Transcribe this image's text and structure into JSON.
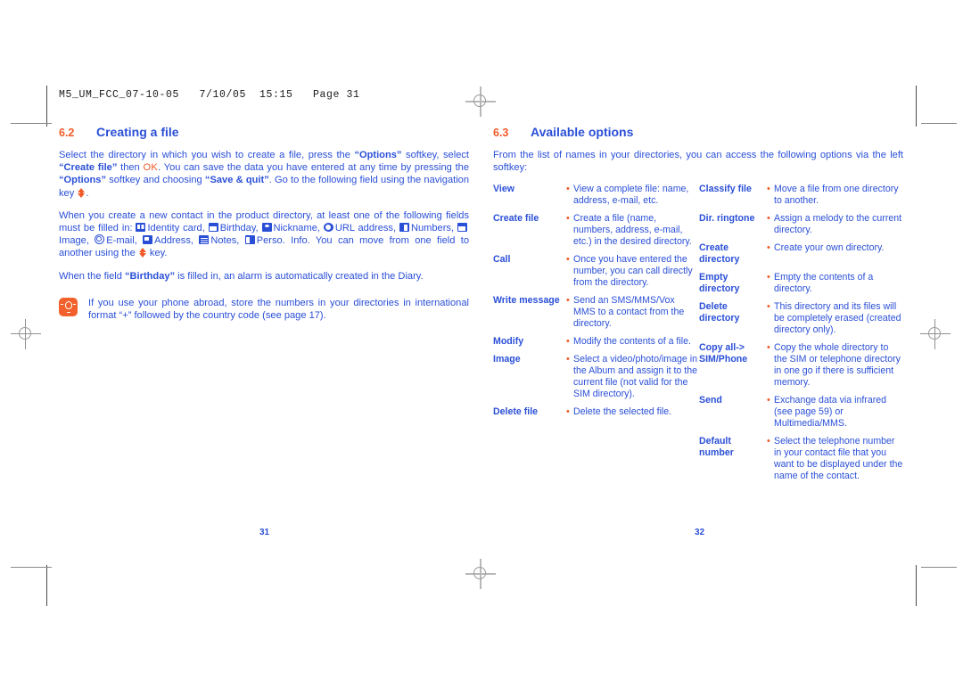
{
  "prepress": {
    "slug": "M5_UM_FCC_07-10-05   7/10/05  15:15   Page 31"
  },
  "colors": {
    "accent_orange": "#F05A28",
    "text_blue": "#2A4FD7",
    "tip_icon_bg": "#F2612C",
    "crop_mark": "#8a8a8a"
  },
  "left_page": {
    "section": {
      "number": "6.2",
      "title": "Creating a file"
    },
    "para1": {
      "t1": "Select the directory in which you wish to create a file, press the ",
      "b1": "“Options”",
      "t2": " softkey, select ",
      "b2": "“Create file”",
      "t3": " then ",
      "ok": "OK",
      "t4": ". You can save the data you have entered at any time by pressing the ",
      "b3": "“Options”",
      "t5": " softkey and choosing ",
      "b4": "“Save & quit”",
      "t6": ". Go to the following field using the navigation key ",
      "t7": "."
    },
    "para2": {
      "t1": "When you create a new contact in the product directory, at least one of the following fields must be filled in: ",
      "items": [
        {
          "icon": "idcard-icon",
          "label": "Identity card,"
        },
        {
          "icon": "cake-icon",
          "label": "Birthday,"
        },
        {
          "icon": "nickname-icon",
          "label": "Nickname,"
        },
        {
          "icon": "url-icon",
          "label": "URL address,"
        },
        {
          "icon": "numbers-icon",
          "label": "Numbers,"
        },
        {
          "icon": "image-icon",
          "label": "Image,"
        },
        {
          "icon": "email-icon",
          "label": "E-mail,"
        },
        {
          "icon": "address-icon",
          "label": "Address,"
        },
        {
          "icon": "notes-icon",
          "label": "Notes,"
        },
        {
          "icon": "perso-info-icon",
          "label": "Perso. Info."
        }
      ],
      "t2": " You can move from one field to another using the ",
      "t3": " key."
    },
    "para3": {
      "t1": "When the field ",
      "b1": "“Birthday”",
      "t2": " is filled in, an alarm is automatically created in the Diary."
    },
    "tip": {
      "icon": "tip-bulb-icon",
      "text": "If you use your phone abroad, store the numbers in your directories in international format “+” followed by the country code (see page 17)."
    },
    "page_number": "31"
  },
  "right_page": {
    "section": {
      "number": "6.3",
      "title": "Available options"
    },
    "intro": "From the list of names in your directories, you can access the following options via the left softkey:",
    "bullet": "•",
    "options_left": [
      {
        "term": "View",
        "definition": "View a complete file: name, address, e-mail, etc."
      },
      {
        "term": "Create file",
        "definition": "Create a file (name, numbers, address, e-mail, etc.) in the desired directory."
      },
      {
        "term": "Call",
        "definition": "Once you have entered the number, you can call directly from the directory."
      },
      {
        "term": "Write message",
        "definition": "Send an SMS/MMS/Vox MMS to a contact from the directory."
      },
      {
        "term": "Modify",
        "definition": "Modify the contents of a file."
      },
      {
        "term": "Image",
        "definition": "Select a video/photo/image in the Album and assign it to the current file (not valid for the SIM directory)."
      },
      {
        "term": "Delete file",
        "definition": "Delete the selected file."
      }
    ],
    "options_right": [
      {
        "term": "Classify file",
        "definition": "Move a file from one directory to another."
      },
      {
        "term": "Dir. ringtone",
        "definition": "Assign a melody to the current directory."
      },
      {
        "term": "Create directory",
        "definition": "Create your own directory."
      },
      {
        "term": "Empty directory",
        "definition": "Empty the contents of a directory."
      },
      {
        "term": "Delete directory",
        "definition": "This directory and its files will be completely erased (created directory only)."
      },
      {
        "term": "Copy all-> SIM/Phone",
        "definition": "Copy the whole directory to the SIM or telephone directory in one go if there is sufficient memory."
      },
      {
        "term": "Send",
        "definition": "Exchange data via infrared (see page 59) or Multimedia/MMS."
      },
      {
        "term": "Default number",
        "definition": "Select the telephone number in your contact file that you want to be displayed under the name of the contact."
      }
    ],
    "page_number": "32"
  }
}
